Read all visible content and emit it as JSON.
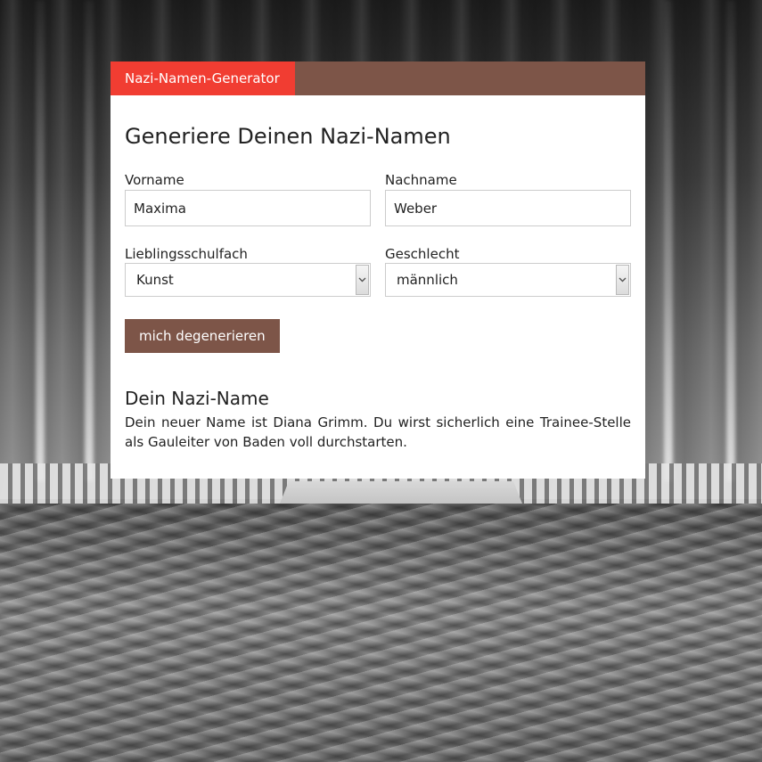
{
  "header": {
    "tab_label": "Nazi-Namen-Generator"
  },
  "form": {
    "title": "Generiere Deinen Nazi-Namen",
    "first_name": {
      "label": "Vorname",
      "value": "Maxima"
    },
    "last_name": {
      "label": "Nachname",
      "value": "Weber"
    },
    "subject": {
      "label": "Lieblingsschulfach",
      "selected": "Kunst"
    },
    "gender": {
      "label": "Geschlecht",
      "selected": "männlich"
    },
    "submit_label": "mich degenerieren"
  },
  "result": {
    "title": "Dein Nazi-Name",
    "text": "Dein neuer Name ist Diana Grimm. Du wirst sicherlich eine Trainee-Stelle als Gauleiter von Baden voll durchstarten."
  },
  "colors": {
    "accent": "#f13d32",
    "brand_brown": "#7d5548"
  },
  "icons": {
    "select_arrow": "chevron-down-icon"
  }
}
